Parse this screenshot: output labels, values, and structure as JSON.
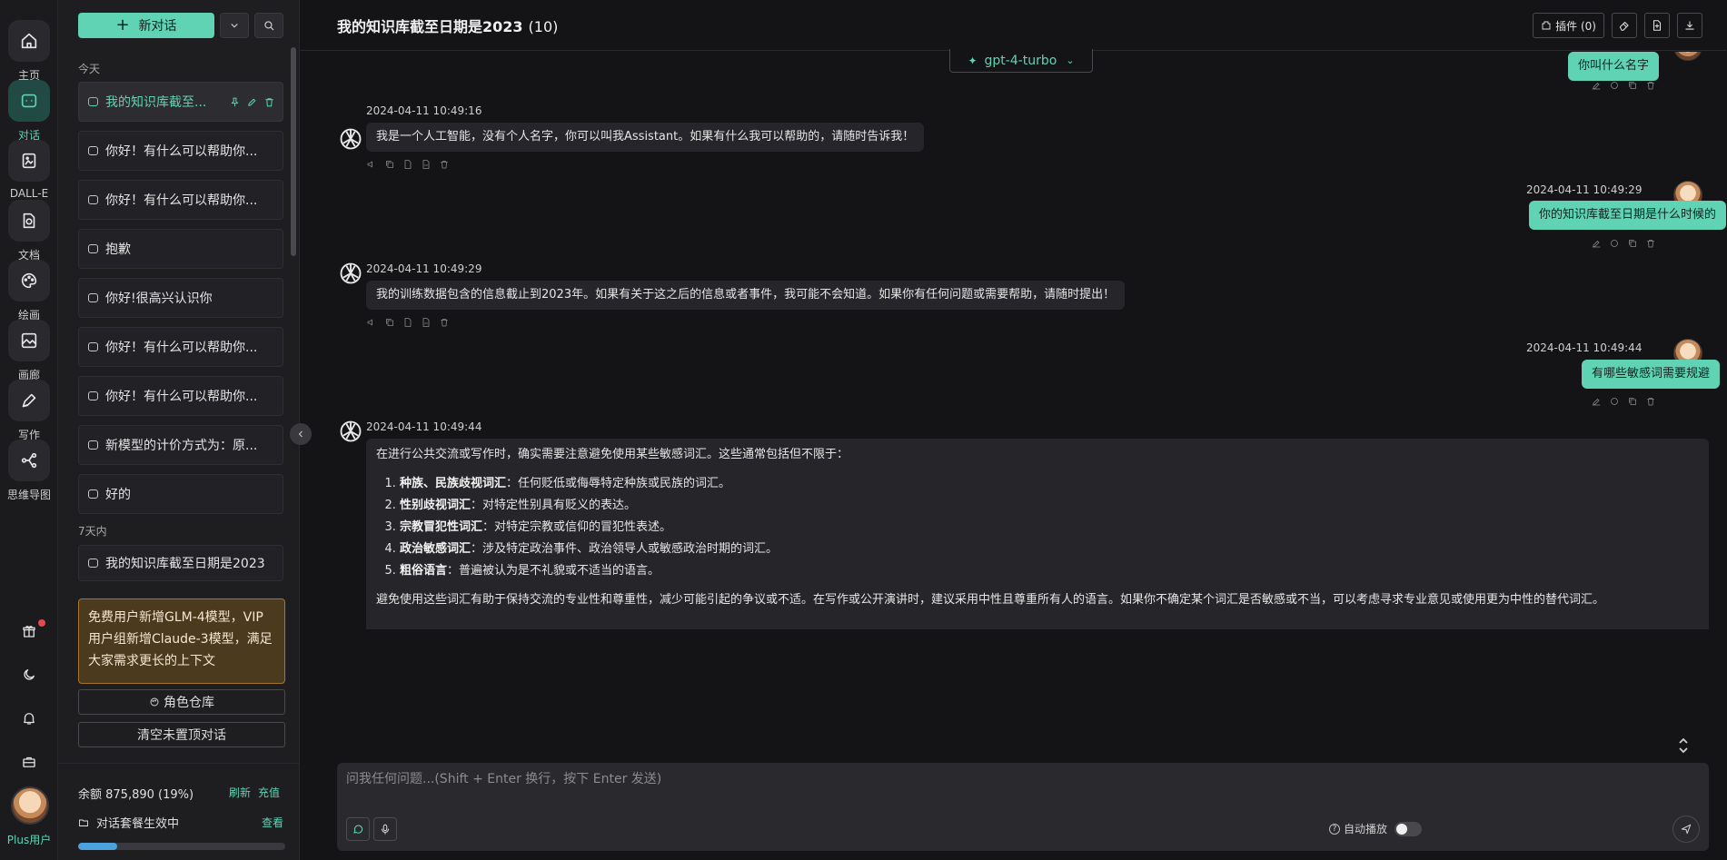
{
  "rail": {
    "items": [
      {
        "label": "主页",
        "icon": "home-icon"
      },
      {
        "label": "对话",
        "icon": "chat-icon"
      },
      {
        "label": "DALL-E",
        "icon": "image-edit-icon"
      },
      {
        "label": "文档",
        "icon": "document-icon"
      },
      {
        "label": "绘画",
        "icon": "palette-icon"
      },
      {
        "label": "画廊",
        "icon": "gallery-icon"
      },
      {
        "label": "写作",
        "icon": "pen-icon"
      },
      {
        "label": "思维导图",
        "icon": "mindmap-icon"
      }
    ],
    "plus_label": "Plus用户"
  },
  "sidebar": {
    "new_chat_label": "新对话",
    "group_today": "今天",
    "group_week": "7天内",
    "conversations": [
      {
        "title": "我的知识库截至..."
      },
      {
        "title": "你好！有什么可以帮助你..."
      },
      {
        "title": "你好！有什么可以帮助你..."
      },
      {
        "title": "抱歉"
      },
      {
        "title": "你好!很高兴认识你"
      },
      {
        "title": "你好！有什么可以帮助你..."
      },
      {
        "title": "你好！有什么可以帮助你..."
      },
      {
        "title": "新模型的计价方式为：原..."
      },
      {
        "title": "好的"
      }
    ],
    "week_conversations": [
      {
        "title": "我的知识库截至日期是2023"
      }
    ],
    "notice": "免费用户新增GLM-4模型，VIP用户组新增Claude-3模型，满足大家需求更长的上下文",
    "role_store_label": "角色仓库",
    "clear_label": "清空未置顶对话",
    "balance_label": "余额 875,890 (19%)",
    "refresh_label": "刷新",
    "recharge_label": "充值",
    "plan_label": "对话套餐生效中",
    "view_label": "查看",
    "balance_percent": 19
  },
  "header": {
    "title": "我的知识库截至日期是2023",
    "count": "(10)",
    "plugin_label": "插件 (0)"
  },
  "model": {
    "name": "gpt-4-turbo"
  },
  "messages": [
    {
      "role": "user",
      "text": "你叫什么名字"
    },
    {
      "role": "assistant",
      "time": "2024-04-11 10:49:16",
      "text": "我是一个人工智能，没有个人名字，你可以叫我Assistant。如果有什么我可以帮助的，请随时告诉我！"
    },
    {
      "role": "user",
      "time": "2024-04-11 10:49:29",
      "text": "你的知识库截至日期是什么时候的"
    },
    {
      "role": "assistant",
      "time": "2024-04-11 10:49:29",
      "text": "我的训练数据包含的信息截止到2023年。如果有关于这之后的信息或者事件，我可能不会知道。如果你有任何问题或需要帮助，请随时提出！"
    },
    {
      "role": "user",
      "time": "2024-04-11 10:49:44",
      "text": "有哪些敏感词需要规避"
    },
    {
      "role": "assistant",
      "time": "2024-04-11 10:49:44",
      "intro": "在进行公共交流或写作时，确实需要注意避免使用某些敏感词汇。这些通常包括但不限于：",
      "list": [
        {
          "term": "种族、民族歧视词汇",
          "desc": "：任何贬低或侮辱特定种族或民族的词汇。"
        },
        {
          "term": "性别歧视词汇",
          "desc": "：对特定性别具有贬义的表达。"
        },
        {
          "term": "宗教冒犯性词汇",
          "desc": "：对特定宗教或信仰的冒犯性表述。"
        },
        {
          "term": "政治敏感词汇",
          "desc": "：涉及特定政治事件、政治领导人或敏感政治时期的词汇。"
        },
        {
          "term": "粗俗语言",
          "desc": "：普遍被认为是不礼貌或不适当的语言。"
        }
      ],
      "outro": "避免使用这些词汇有助于保持交流的专业性和尊重性，减少可能引起的争议或不适。在写作或公开演讲时，建议采用中性且尊重所有人的语言。如果你不确定某个词汇是否敏感或不当，可以考虑寻求专业意见或使用更为中性的替代词汇。"
    }
  ],
  "composer": {
    "placeholder": "问我任何问题...(Shift + Enter 换行，按下 Enter 发送)",
    "auto_play_label": "自动播放"
  },
  "colors": {
    "accent": "#5fd3b3",
    "notice_bg": "#4b3a1e",
    "background": "#141416"
  }
}
